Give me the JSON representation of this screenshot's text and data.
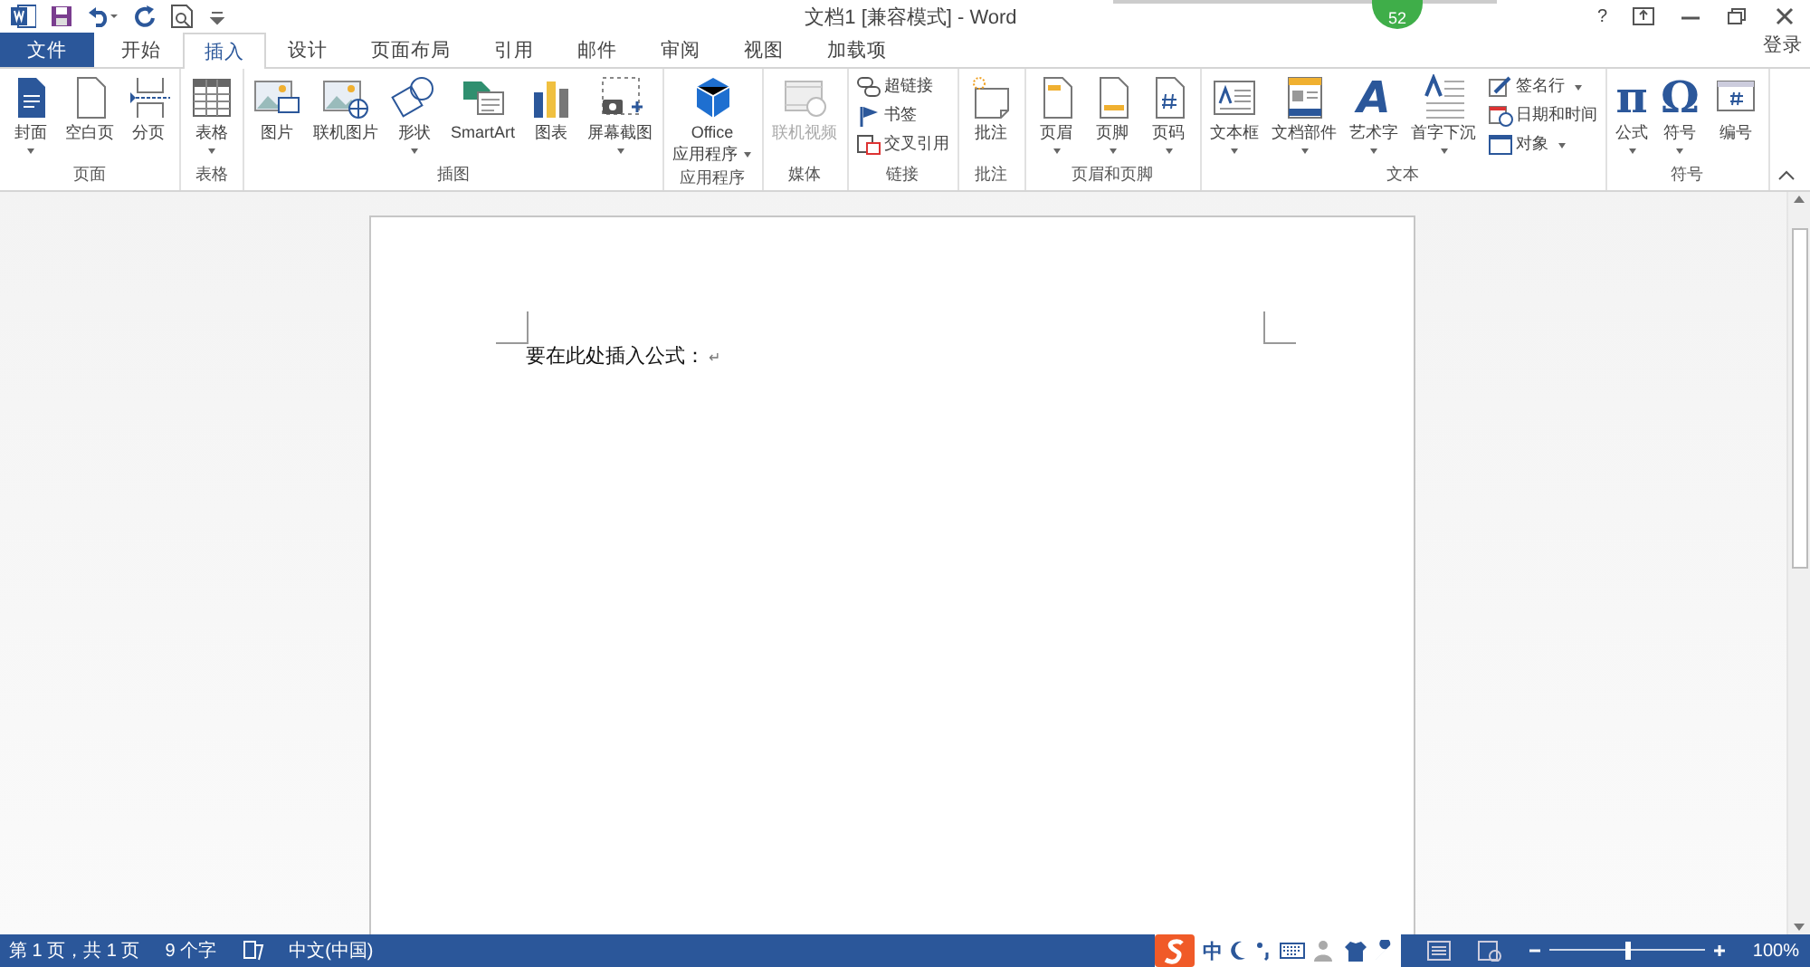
{
  "window": {
    "title": "文档1 [兼容模式] - Word",
    "badge": "52",
    "help": "?",
    "sign_in": "登录"
  },
  "tabs": [
    {
      "label": "文件",
      "kind": "file",
      "selected": false
    },
    {
      "label": "开始",
      "kind": "tab",
      "selected": false
    },
    {
      "label": "插入",
      "kind": "tab",
      "selected": true
    },
    {
      "label": "设计",
      "kind": "tab",
      "selected": false
    },
    {
      "label": "页面布局",
      "kind": "tab",
      "selected": false
    },
    {
      "label": "引用",
      "kind": "tab",
      "selected": false
    },
    {
      "label": "邮件",
      "kind": "tab",
      "selected": false
    },
    {
      "label": "审阅",
      "kind": "tab",
      "selected": false
    },
    {
      "label": "视图",
      "kind": "tab",
      "selected": false
    },
    {
      "label": "加载项",
      "kind": "tab",
      "selected": false
    }
  ],
  "ribbon": {
    "groups": [
      {
        "name": "页面",
        "buttons": [
          {
            "kind": "large",
            "label": "封面",
            "dropdown": true,
            "disabled": false
          },
          {
            "kind": "large",
            "label": "空白页",
            "dropdown": false,
            "disabled": false
          },
          {
            "kind": "large",
            "label": "分页",
            "dropdown": false,
            "disabled": false
          }
        ]
      },
      {
        "name": "表格",
        "buttons": [
          {
            "kind": "large",
            "label": "表格",
            "dropdown": true,
            "disabled": false
          }
        ]
      },
      {
        "name": "插图",
        "buttons": [
          {
            "kind": "large",
            "label": "图片",
            "dropdown": false,
            "disabled": false
          },
          {
            "kind": "large",
            "label": "联机图片",
            "dropdown": false,
            "disabled": false
          },
          {
            "kind": "large",
            "label": "形状",
            "dropdown": true,
            "disabled": false
          },
          {
            "kind": "large",
            "label": "SmartArt",
            "dropdown": false,
            "disabled": false
          },
          {
            "kind": "large",
            "label": "图表",
            "dropdown": false,
            "disabled": false
          },
          {
            "kind": "large",
            "label": "屏幕截图",
            "dropdown": true,
            "disabled": false
          }
        ]
      },
      {
        "name": "应用程序",
        "buttons": [
          {
            "kind": "large",
            "label": "Office",
            "sublabel": "应用程序",
            "dropdown": true,
            "disabled": false
          }
        ]
      },
      {
        "name": "媒体",
        "buttons": [
          {
            "kind": "large",
            "label": "联机视频",
            "dropdown": false,
            "disabled": true
          }
        ]
      },
      {
        "name": "链接",
        "buttons": [
          {
            "kind": "small",
            "label": "超链接",
            "dropdown": false,
            "disabled": false
          },
          {
            "kind": "small",
            "label": "书签",
            "dropdown": false,
            "disabled": false
          },
          {
            "kind": "small",
            "label": "交叉引用",
            "dropdown": false,
            "disabled": false
          }
        ]
      },
      {
        "name": "批注",
        "buttons": [
          {
            "kind": "large",
            "label": "批注",
            "dropdown": false,
            "disabled": false
          }
        ]
      },
      {
        "name": "页眉和页脚",
        "buttons": [
          {
            "kind": "large",
            "label": "页眉",
            "dropdown": true,
            "disabled": false
          },
          {
            "kind": "large",
            "label": "页脚",
            "dropdown": true,
            "disabled": false
          },
          {
            "kind": "large",
            "label": "页码",
            "dropdown": true,
            "disabled": false
          }
        ]
      },
      {
        "name": "文本",
        "buttons": [
          {
            "kind": "large",
            "label": "文本框",
            "dropdown": true,
            "disabled": false
          },
          {
            "kind": "large",
            "label": "文档部件",
            "dropdown": true,
            "disabled": false
          },
          {
            "kind": "large",
            "label": "艺术字",
            "glyph": "A",
            "dropdown": true,
            "disabled": false
          },
          {
            "kind": "large",
            "label": "首字下沉",
            "dropdown": true,
            "disabled": false
          },
          {
            "kind": "small",
            "label": "签名行",
            "dropdown": true,
            "disabled": false
          },
          {
            "kind": "small",
            "label": "日期和时间",
            "dropdown": false,
            "disabled": false
          },
          {
            "kind": "small",
            "label": "对象",
            "dropdown": true,
            "disabled": false
          }
        ]
      },
      {
        "name": "符号",
        "buttons": [
          {
            "kind": "large",
            "label": "公式",
            "glyph": "π",
            "dropdown": true,
            "disabled": false
          },
          {
            "kind": "large",
            "label": "符号",
            "glyph": "Ω",
            "dropdown": true,
            "disabled": false
          },
          {
            "kind": "large",
            "label": "编号",
            "dropdown": false,
            "disabled": false
          }
        ]
      }
    ]
  },
  "document": {
    "paragraph": "要在此处插入公式：",
    "mark": "↵"
  },
  "status_bar": {
    "page": "第 1 页，共 1 页",
    "words": "9 个字",
    "language": "中文(中国)",
    "ime": "中",
    "zoom": {
      "level": 0.5,
      "reading": "100%"
    }
  }
}
